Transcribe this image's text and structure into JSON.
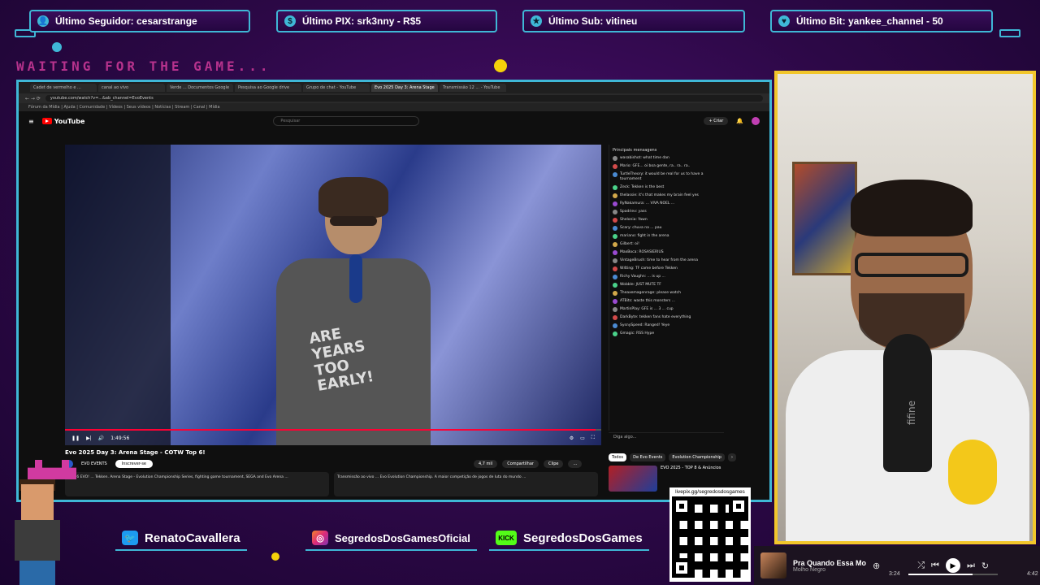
{
  "alerts": {
    "follower": "Último Seguidor: cesarstrange",
    "pix": "Último PIX: srk3nny - R$5",
    "sub": "Último Sub: vitineu",
    "bit": "Último Bit: yankee_channel - 50"
  },
  "waiting_text": "WAITING FOR THE GAME...",
  "browser": {
    "tabs": [
      "Cadet de vermelho e ...",
      "canal ao vivo",
      "Verde ... Documentos Google",
      "Pesquisa ao Google drive",
      "Grupo de chat - YouTube",
      "Evo 2025 Day 3: Arena Stage",
      "Transmissão 12 ... - YouTube"
    ],
    "url": "youtube.com/watch?v=...&ab_channel=EvoEvents",
    "bookmarks": "Fórum da Mídia | Ajuda | Comunidade | Vídeos | Seus vídeos | Notícias | Stream | Canal | Mídia"
  },
  "youtube": {
    "logo": "YouTube",
    "search_placeholder": "Pesquisar",
    "create_label": "+ Criar",
    "video_title": "Evo 2025 Day 3: Arena Stage - COTW Top 6!",
    "channel_name": "EVO EVENTS",
    "subscribe_label": "Inscrever-se",
    "actions": [
      "4,7 mil",
      "Compartilhar",
      "Clipe",
      "..."
    ],
    "time": "1:49:56",
    "chat_header": "Principais mensagens",
    "chat_input_placeholder": "Diga algo...",
    "chat_messages": [
      "wasabishot: what time dan",
      "Mario: GFE... oi boa gente, ra.. ra.. ra..",
      "TurtleTheory: it would be real for us to have a tournament",
      "Zeck: Tekken is the best",
      "thelassie: it's that makes my brain feel yes",
      "RyNakamura: ... VIVA NOEL ...",
      "Spadriev: yass",
      "Shelonia: Yawn",
      "Scary: chuva na ... pau",
      "mariano: fight in the arena",
      "Gilbert: oi!",
      "MaxBoca: ROSASIERIUS",
      "VintageBrush: time to hear from the arena",
      "W4ting: TF came before Tekken",
      "Richy Vaughn: ... is up ...",
      "Wobble: JUST MUTE TF",
      "Theaxemagenrage: please watch",
      "ATBits: waste this monsters ...",
      "MartinPlay: GFE is ... 3 ... cup",
      "DarkByte: tekken fans hate everything",
      "SysnySpeed: Ranged! Yeye",
      "Gmagic: RSS Hype"
    ],
    "chips": [
      "Todos",
      "De Evo Events",
      "Evolution Championship",
      "›"
    ],
    "rec_title": "EVO 2025 - TOP 8 & Anúncios",
    "description": "TOP 6 EVO! ... Tekken. Arena Stage - Evolution Championship Series, fighting game tournament, SEGA and Evo Arena ...",
    "description2": "Transmissão ao vivo ... Evo Evolution Championship. A maior competição de jogos de luta do mundo ..."
  },
  "socials": {
    "twitter": "RenatoCavallera",
    "instagram": "SegredosDosGamesOficial",
    "kick_badge": "KICK",
    "kick": "SegredosDosGames"
  },
  "qr_caption": "livepix.gg/segredosdosgames",
  "player": {
    "song": "Pra Quando Essa Mo...",
    "artist": "Molho Negro",
    "elapsed": "3:24",
    "total": "4:42",
    "progress": 0.72
  },
  "webcam_mic_brand": "fifine",
  "colors": {
    "accent": "#3fb7d6",
    "cam_border": "#f2c62b",
    "background": "#2c0846",
    "waiting": "#d03a9a"
  },
  "icons": [
    "person-icon",
    "dollar-icon",
    "star-icon",
    "heart-icon",
    "twitter-icon",
    "instagram-icon",
    "kick-icon",
    "shuffle-icon",
    "prev-icon",
    "play-icon",
    "next-icon",
    "repeat-icon"
  ]
}
